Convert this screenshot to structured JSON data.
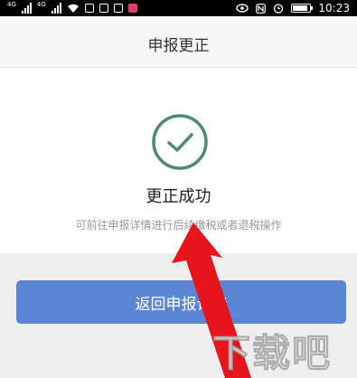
{
  "status": {
    "time": "10:23",
    "net1": "4G",
    "net2": "4G",
    "left_icons": [
      "signal-icon",
      "wifi-icon",
      "video-icon",
      "message-icon",
      "app-icon"
    ],
    "right_icons": [
      "eye-icon",
      "nfc-icon",
      "alarm-icon",
      "battery-icon"
    ]
  },
  "header": {
    "title": "申报更正"
  },
  "result": {
    "icon": "check-circle-icon",
    "title": "更正成功",
    "subtitle": "可前往申报详情进行后续缴税或者退税操作",
    "accent": "#4e8a78"
  },
  "button": {
    "label": "返回申报详情",
    "color": "#5b86d6"
  },
  "overlay": {
    "arrow_color": "#e8141b",
    "watermark": "下载吧"
  }
}
